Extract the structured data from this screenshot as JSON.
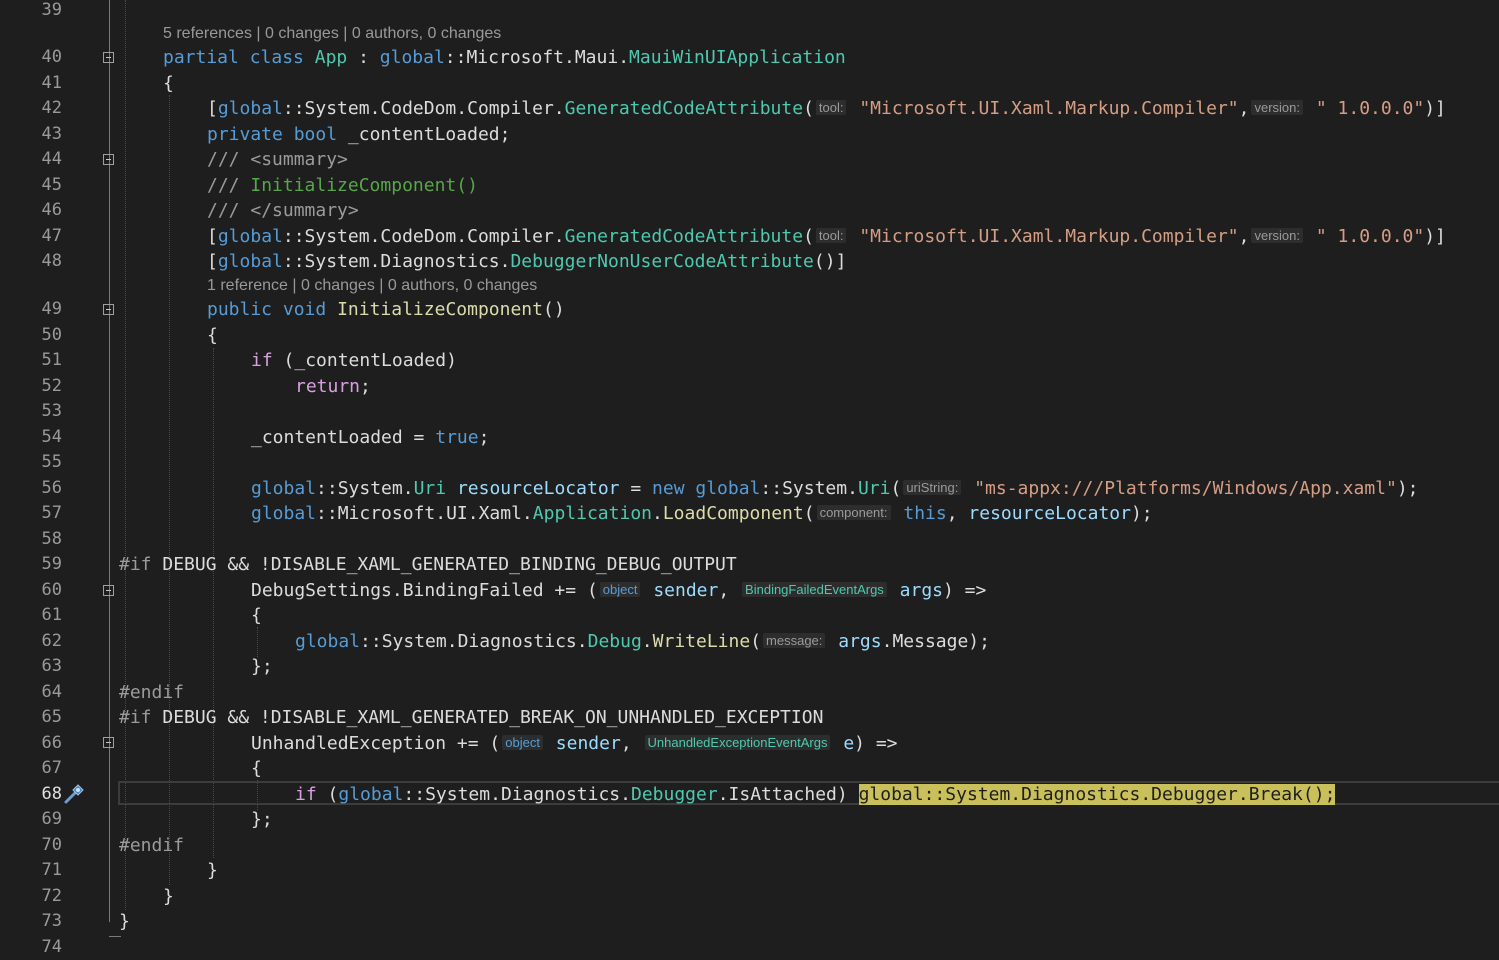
{
  "editor": {
    "lines": [
      {
        "n": "39",
        "segs": []
      },
      {
        "n": "40",
        "segs": [
          [
            "kw",
            "partial"
          ],
          [
            "p",
            " "
          ],
          [
            "kw",
            "class"
          ],
          [
            "p",
            " "
          ],
          [
            "ty",
            "App"
          ],
          [
            "p",
            " : "
          ],
          [
            "kw",
            "global"
          ],
          [
            "p",
            "::Microsoft.Maui."
          ],
          [
            "ty",
            "MauiWinUIApplication"
          ]
        ]
      },
      {
        "n": "41",
        "segs": [
          [
            "p",
            "{"
          ]
        ]
      },
      {
        "n": "42",
        "segs": [
          [
            "p",
            "["
          ],
          [
            "kw",
            "global"
          ],
          [
            "p",
            "::System.CodeDom.Compiler."
          ],
          [
            "ty",
            "GeneratedCodeAttribute"
          ],
          [
            "p",
            "("
          ],
          [
            "h",
            "tool:"
          ],
          [
            "p",
            " "
          ],
          [
            "st",
            "\"Microsoft.UI.Xaml.Markup.Compiler\""
          ],
          [
            "p",
            ","
          ],
          [
            "h",
            "version:"
          ],
          [
            "p",
            " "
          ],
          [
            "st",
            "\" 1.0.0.0\""
          ],
          [
            "p",
            ")]"
          ]
        ]
      },
      {
        "n": "43",
        "segs": [
          [
            "kw",
            "private"
          ],
          [
            "p",
            " "
          ],
          [
            "kw",
            "bool"
          ],
          [
            "p",
            " _contentLoaded;"
          ]
        ]
      },
      {
        "n": "44",
        "segs": [
          [
            "mu",
            "///"
          ],
          [
            "cm",
            " "
          ],
          [
            "mu",
            "<summary>"
          ]
        ]
      },
      {
        "n": "45",
        "segs": [
          [
            "mu",
            "///"
          ],
          [
            "cm",
            " InitializeComponent()"
          ]
        ]
      },
      {
        "n": "46",
        "segs": [
          [
            "mu",
            "///"
          ],
          [
            "cm",
            " "
          ],
          [
            "mu",
            "</summary>"
          ]
        ]
      },
      {
        "n": "47",
        "segs": [
          [
            "p",
            "["
          ],
          [
            "kw",
            "global"
          ],
          [
            "p",
            "::System.CodeDom.Compiler."
          ],
          [
            "ty",
            "GeneratedCodeAttribute"
          ],
          [
            "p",
            "("
          ],
          [
            "h",
            "tool:"
          ],
          [
            "p",
            " "
          ],
          [
            "st",
            "\"Microsoft.UI.Xaml.Markup.Compiler\""
          ],
          [
            "p",
            ","
          ],
          [
            "h",
            "version:"
          ],
          [
            "p",
            " "
          ],
          [
            "st",
            "\" 1.0.0.0\""
          ],
          [
            "p",
            ")]"
          ]
        ]
      },
      {
        "n": "48",
        "segs": [
          [
            "p",
            "["
          ],
          [
            "kw",
            "global"
          ],
          [
            "p",
            "::System.Diagnostics."
          ],
          [
            "ty",
            "DebuggerNonUserCodeAttribute"
          ],
          [
            "p",
            "()]"
          ]
        ]
      },
      {
        "n": "49",
        "segs": [
          [
            "kw",
            "public"
          ],
          [
            "p",
            " "
          ],
          [
            "kw",
            "void"
          ],
          [
            "p",
            " "
          ],
          [
            "fn",
            "InitializeComponent"
          ],
          [
            "p",
            "()"
          ]
        ]
      },
      {
        "n": "50",
        "segs": [
          [
            "p",
            "{"
          ]
        ]
      },
      {
        "n": "51",
        "segs": [
          [
            "ct",
            "if"
          ],
          [
            "p",
            " (_contentLoaded)"
          ]
        ]
      },
      {
        "n": "52",
        "segs": [
          [
            "ct",
            "return"
          ],
          [
            "p",
            ";"
          ]
        ]
      },
      {
        "n": "53",
        "segs": []
      },
      {
        "n": "54",
        "segs": [
          [
            "p",
            "_contentLoaded = "
          ],
          [
            "kw",
            "true"
          ],
          [
            "p",
            ";"
          ]
        ]
      },
      {
        "n": "55",
        "segs": []
      },
      {
        "n": "56",
        "segs": [
          [
            "kw",
            "global"
          ],
          [
            "p",
            "::System."
          ],
          [
            "ty",
            "Uri"
          ],
          [
            "p",
            " "
          ],
          [
            "pa",
            "resourceLocator"
          ],
          [
            "p",
            " = "
          ],
          [
            "kw",
            "new"
          ],
          [
            "p",
            " "
          ],
          [
            "kw",
            "global"
          ],
          [
            "p",
            "::System."
          ],
          [
            "ty",
            "Uri"
          ],
          [
            "p",
            "("
          ],
          [
            "h",
            "uriString:"
          ],
          [
            "p",
            " "
          ],
          [
            "st",
            "\"ms-appx:///Platforms/Windows/App.xaml\""
          ],
          [
            "p",
            ");"
          ]
        ]
      },
      {
        "n": "57",
        "segs": [
          [
            "kw",
            "global"
          ],
          [
            "p",
            "::Microsoft.UI.Xaml."
          ],
          [
            "ty",
            "Application"
          ],
          [
            "p",
            "."
          ],
          [
            "fn",
            "LoadComponent"
          ],
          [
            "p",
            "("
          ],
          [
            "h",
            "component:"
          ],
          [
            "p",
            " "
          ],
          [
            "kw",
            "this"
          ],
          [
            "p",
            ", "
          ],
          [
            "pa",
            "resourceLocator"
          ],
          [
            "p",
            ");"
          ]
        ]
      },
      {
        "n": "58",
        "segs": []
      },
      {
        "n": "59",
        "segs": [
          [
            "mu",
            "#if"
          ],
          [
            "p",
            " DEBUG && !DISABLE_XAML_GENERATED_BINDING_DEBUG_OUTPUT"
          ]
        ]
      },
      {
        "n": "60",
        "segs": [
          [
            "p",
            "DebugSettings.BindingFailed += ("
          ],
          [
            "hk",
            "object"
          ],
          [
            "p",
            " "
          ],
          [
            "pa",
            "sender"
          ],
          [
            "p",
            ", "
          ],
          [
            "ht",
            "BindingFailedEventArgs"
          ],
          [
            "p",
            " "
          ],
          [
            "pa",
            "args"
          ],
          [
            "p",
            ") =>"
          ]
        ]
      },
      {
        "n": "61",
        "segs": [
          [
            "p",
            "{"
          ]
        ]
      },
      {
        "n": "62",
        "segs": [
          [
            "kw",
            "global"
          ],
          [
            "p",
            "::System.Diagnostics."
          ],
          [
            "ty",
            "Debug"
          ],
          [
            "p",
            "."
          ],
          [
            "fn",
            "WriteLine"
          ],
          [
            "p",
            "("
          ],
          [
            "h",
            "message:"
          ],
          [
            "p",
            " "
          ],
          [
            "pa",
            "args"
          ],
          [
            "p",
            ".Message);"
          ]
        ]
      },
      {
        "n": "63",
        "segs": [
          [
            "p",
            "};"
          ]
        ]
      },
      {
        "n": "64",
        "segs": [
          [
            "mu",
            "#endif"
          ]
        ]
      },
      {
        "n": "65",
        "segs": [
          [
            "mu",
            "#if"
          ],
          [
            "p",
            " DEBUG && !DISABLE_XAML_GENERATED_BREAK_ON_UNHANDLED_EXCEPTION"
          ]
        ]
      },
      {
        "n": "66",
        "segs": [
          [
            "p",
            "UnhandledException += ("
          ],
          [
            "hk",
            "object"
          ],
          [
            "p",
            " "
          ],
          [
            "pa",
            "sender"
          ],
          [
            "p",
            ", "
          ],
          [
            "ht",
            "UnhandledExceptionEventArgs"
          ],
          [
            "p",
            " "
          ],
          [
            "pa",
            "e"
          ],
          [
            "p",
            ") =>"
          ]
        ]
      },
      {
        "n": "67",
        "segs": [
          [
            "p",
            "{"
          ]
        ]
      },
      {
        "n": "68",
        "segs": [
          [
            "ct",
            "if"
          ],
          [
            "p",
            " ("
          ],
          [
            "kw",
            "global"
          ],
          [
            "p",
            "::System.Diagnostics."
          ],
          [
            "ty",
            "Debugger"
          ],
          [
            "p",
            ".IsAttached) "
          ],
          [
            "hl",
            "global::System.Diagnostics.Debugger.Break();"
          ]
        ]
      },
      {
        "n": "69",
        "segs": [
          [
            "p",
            "};"
          ]
        ]
      },
      {
        "n": "70",
        "segs": [
          [
            "mu",
            "#endif"
          ]
        ]
      },
      {
        "n": "71",
        "segs": [
          [
            "p",
            "}"
          ]
        ]
      },
      {
        "n": "72",
        "segs": [
          [
            "p",
            "}"
          ]
        ]
      },
      {
        "n": "73",
        "segs": [
          [
            "p",
            "}"
          ]
        ]
      },
      {
        "n": "74",
        "segs": []
      }
    ],
    "codelens": [
      {
        "text": "5 references | 0 changes | 0 authors, 0 changes"
      },
      {
        "text": "1 reference | 0 changes | 0 authors, 0 changes"
      }
    ],
    "current_line": "68",
    "breakpoint_icon": "breakpoint-settings-icon"
  }
}
